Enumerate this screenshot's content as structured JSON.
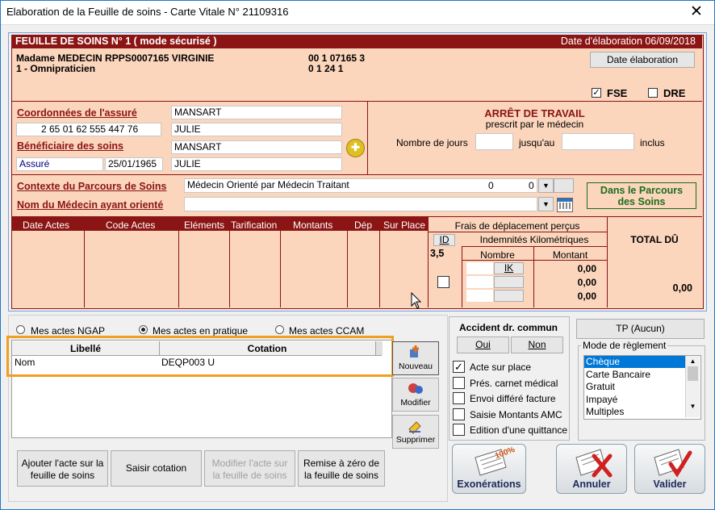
{
  "window": {
    "title": "Elaboration de la Feuille de soins - Carte Vitale N° 21109316",
    "close_glyph": "✕"
  },
  "sheet": {
    "header_left": "FEUILLE DE SOINS  N° 1 ( mode sécurisé )",
    "header_right": "Date d'élaboration 06/09/2018",
    "practitioner_line1": "Madame MEDECIN RPPS0007165 VIRGINIE",
    "practitioner_line2": "1 - Omnipraticien",
    "code1": "00 1 07165 3",
    "code2": "0 1 24 1",
    "date_button": "Date élaboration",
    "fse_label": "FSE",
    "fse_checked": "✓",
    "dre_label": "DRE",
    "dre_checked": "",
    "insured_title": "Coordonnées de l'assuré",
    "insured_number": "2 65 01 62 555 447 76",
    "insured_lastname": "MANSART",
    "insured_firstname": "JULIE",
    "beneficiary_title": "Bénéficiaire des soins",
    "beneficiary_lastname": "MANSART",
    "beneficiary_firstname": "JULIE",
    "beneficiary_role": "Assuré",
    "beneficiary_birth": "25/01/1965",
    "add_glyph": "✚",
    "arret_title": "ARRÊT DE TRAVAIL",
    "arret_sub": "prescrit par le médecin",
    "nb_jours": "Nombre de jours",
    "jusquau": "jusqu'au",
    "inclus": "inclus",
    "contexte_label": "Contexte du Parcours de Soins",
    "contexte_value": "Médecin Orienté par Médecin Traitant",
    "contexte_zero1": "0",
    "contexte_zero2": "0",
    "nom_medecin_label": "Nom du Médecin ayant orienté",
    "parcours_line1": "Dans le Parcours",
    "parcours_line2": "des Soins",
    "dropdown_glyph": "▼",
    "columns": [
      "Date Actes",
      "Code Actes",
      "Eléments",
      "Tarification",
      "Montants",
      "Dép",
      "Sur Place"
    ],
    "frais_title": "Frais de déplacement perçus",
    "id_label": "ID",
    "ik_title": "Indemnités Kilométriques",
    "id_value": "3,5",
    "nombre": "Nombre",
    "montant": "Montant",
    "ik_label": "IK",
    "amounts": [
      "0,00",
      "0,00",
      "0,00"
    ],
    "total_label": "TOTAL DÛ",
    "total_value": "0,00"
  },
  "acts": {
    "radio_ngap": "Mes actes NGAP",
    "radio_pratique": "Mes actes en pratique",
    "radio_ccam": "Mes actes CCAM",
    "col_libelle": "Libellé",
    "col_cotation": "Cotation",
    "row_libelle": "Nom",
    "row_cotation": "DEQP003 U",
    "nouveau": "Nouveau",
    "modifier": "Modifier",
    "supprimer": "Supprimer",
    "btn_ajouter": [
      "Ajouter l'acte sur la",
      "feuille de soins"
    ],
    "btn_saisir": "Saisir cotation",
    "btn_modifier": [
      "Modifier l'acte sur",
      "la feuille de soins"
    ],
    "btn_remise": [
      "Remise à zéro de",
      "la feuille de soins"
    ]
  },
  "accident": {
    "title": "Accident dr. commun",
    "oui": "Oui",
    "non": "Non",
    "options": [
      "Acte sur place",
      "Prés. carnet médical",
      "Envoi différé facture",
      "Saisie Montants AMC",
      "Edition d'une quittance"
    ],
    "checked_mark": "✓"
  },
  "payment": {
    "tp_button": "TP (Aucun)",
    "mode_title": "Mode de règlement",
    "modes": [
      "Chèque",
      "Carte Bancaire",
      "Gratuit",
      "Impayé",
      "Multiples"
    ]
  },
  "actions": {
    "exonerations": "Exonérations",
    "stamp": "100%",
    "annuler": "Annuler",
    "valider": "Valider"
  },
  "colors": {
    "maroon": "#8b1414",
    "sheet": "#fbd5bc",
    "highlight": "#f0a020",
    "green": "#1a6e1a"
  }
}
